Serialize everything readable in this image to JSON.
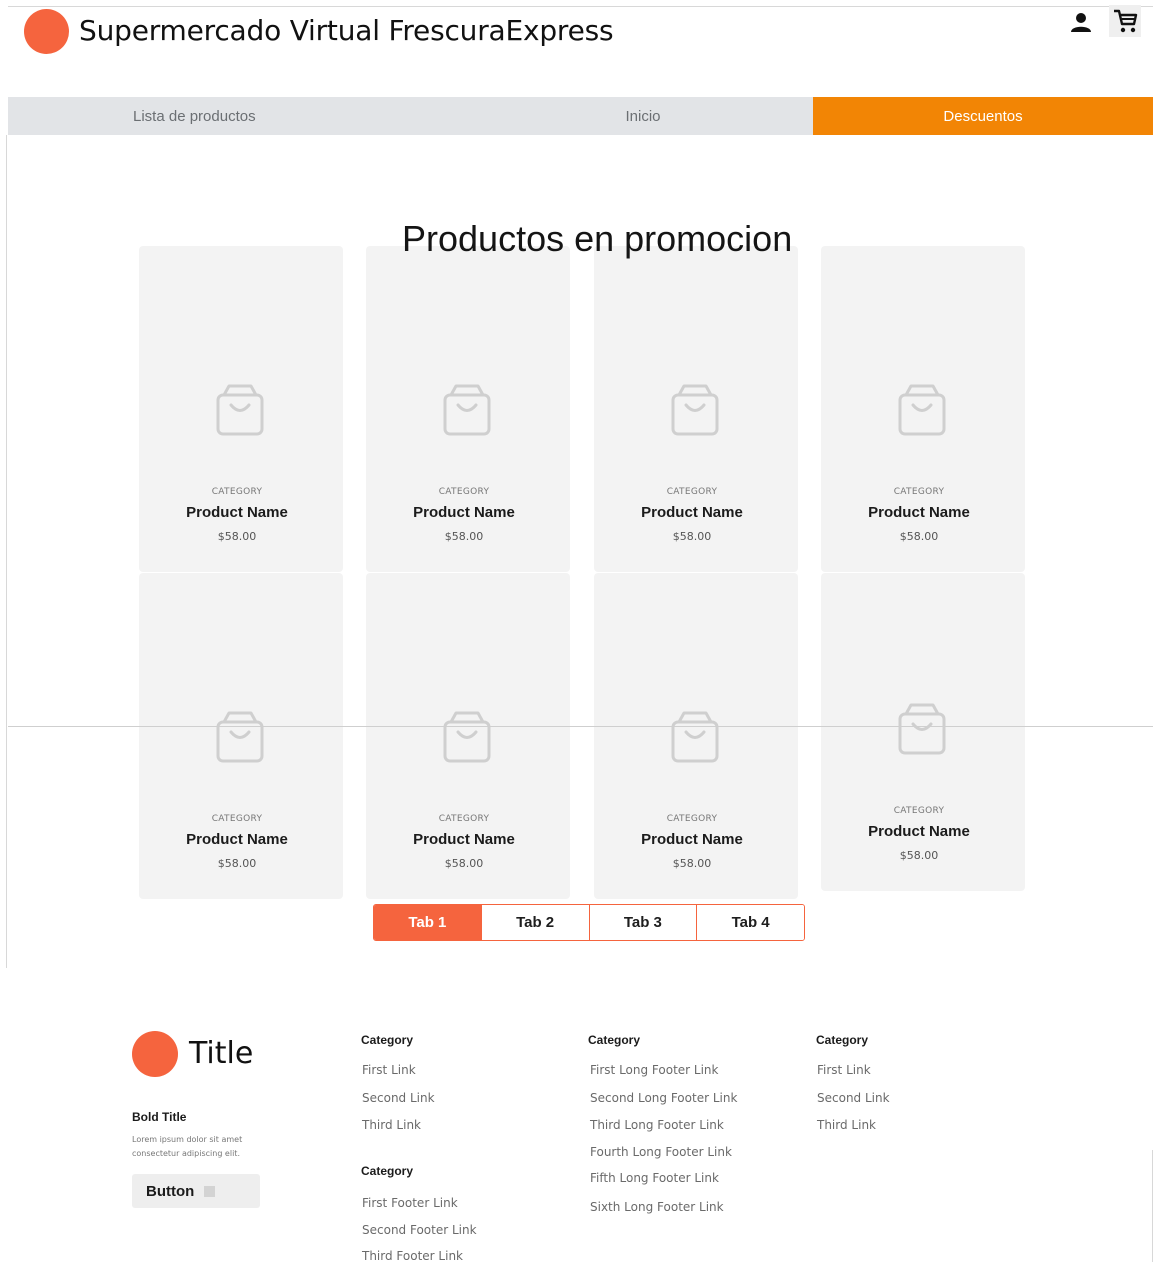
{
  "header": {
    "title": "Supermercado Virtual FrescuraExpress",
    "icons": [
      "user-icon",
      "cart-icon"
    ]
  },
  "nav": {
    "items": [
      "Lista de productos",
      "Inicio",
      "Descuentos"
    ],
    "active": "Descuentos"
  },
  "section": {
    "title": "Productos en promocion"
  },
  "products": [
    {
      "category": "CATEGORY",
      "name": "Product Name",
      "price": "$58.00"
    },
    {
      "category": "CATEGORY",
      "name": "Product Name",
      "price": "$58.00"
    },
    {
      "category": "CATEGORY",
      "name": "Product Name",
      "price": "$58.00"
    },
    {
      "category": "CATEGORY",
      "name": "Product Name",
      "price": "$58.00"
    },
    {
      "category": "CATEGORY",
      "name": "Product Name",
      "price": "$58.00"
    },
    {
      "category": "CATEGORY",
      "name": "Product Name",
      "price": "$58.00"
    },
    {
      "category": "CATEGORY",
      "name": "Product Name",
      "price": "$58.00"
    },
    {
      "category": "CATEGORY",
      "name": "Product Name",
      "price": "$58.00"
    }
  ],
  "tabs": {
    "items": [
      "Tab 1",
      "Tab 2",
      "Tab 3",
      "Tab 4"
    ],
    "active": "Tab 1"
  },
  "footer": {
    "title": "Title",
    "bold_title": "Bold Title",
    "description": "Lorem ipsum dolor sit amet consectetur adipiscing elit.",
    "button_label": "Button",
    "columns": [
      {
        "category": "Category",
        "links": [
          "First Link",
          "Second Link",
          "Third Link"
        ]
      },
      {
        "category": "Category",
        "links": [
          "First Footer Link",
          "Second Footer Link",
          "Third Footer Link"
        ]
      },
      {
        "category": "Category",
        "links": [
          "First Long Footer Link",
          "Second Long Footer Link",
          "Third Long Footer Link",
          "Fourth Long Footer Link",
          "Fifth Long Footer Link",
          "Sixth Long Footer Link"
        ]
      },
      {
        "category": "Category",
        "links": [
          "First Link",
          "Second Link",
          "Third Link"
        ]
      }
    ]
  },
  "colors": {
    "brand": "#f5643e",
    "nav_active": "#f28505",
    "nav_bg": "#e2e4e7",
    "card_bg": "#f3f3f3"
  }
}
